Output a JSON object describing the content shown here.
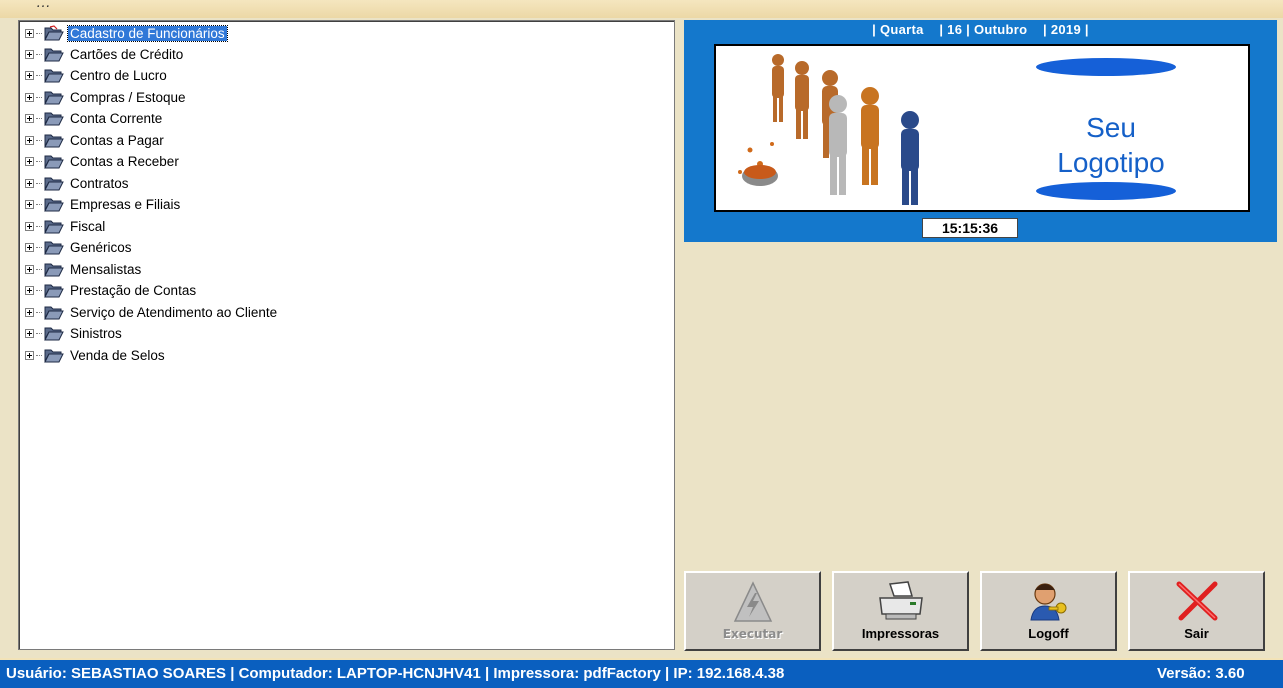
{
  "window": {
    "title": "…"
  },
  "tree": {
    "items": [
      {
        "label": "Cadastro de Funcionários",
        "selected": true
      },
      {
        "label": "Cartões de Crédito"
      },
      {
        "label": "Centro de Lucro"
      },
      {
        "label": "Compras / Estoque"
      },
      {
        "label": "Conta Corrente"
      },
      {
        "label": "Contas a Pagar"
      },
      {
        "label": "Contas a Receber"
      },
      {
        "label": "Contratos"
      },
      {
        "label": "Empresas e Filiais"
      },
      {
        "label": "Fiscal"
      },
      {
        "label": "Genéricos"
      },
      {
        "label": "Mensalistas"
      },
      {
        "label": "Prestação de Contas"
      },
      {
        "label": "Serviço de Atendimento ao Cliente"
      },
      {
        "label": "Sinistros"
      },
      {
        "label": "Venda de Selos"
      }
    ]
  },
  "header": {
    "date": "| Quarta    | 16 | Outubro    | 2019 |"
  },
  "logo": {
    "line1": "Seu",
    "line2": "Logotipo"
  },
  "clock": "15:15:36",
  "buttons": {
    "executar": "Executar",
    "impressoras": "Impressoras",
    "logoff": "Logoff",
    "sair": "Sair"
  },
  "status": {
    "left": "Usuário: SEBASTIAO SOARES | Computador: LAPTOP-HCNJHV41 | Impressora: pdfFactory | IP: 192.168.4.38",
    "version": "Versão: 3.60"
  },
  "colors": {
    "accent": "#1478cc",
    "statusbar": "#0a5fbf",
    "selection": "#3078d8",
    "background": "#f2e3b8"
  },
  "icons": {
    "tree": "open-folder-icon",
    "executar": "lightning-icon",
    "impressoras": "printer-icon",
    "logoff": "user-key-icon",
    "sair": "red-x-icon"
  }
}
